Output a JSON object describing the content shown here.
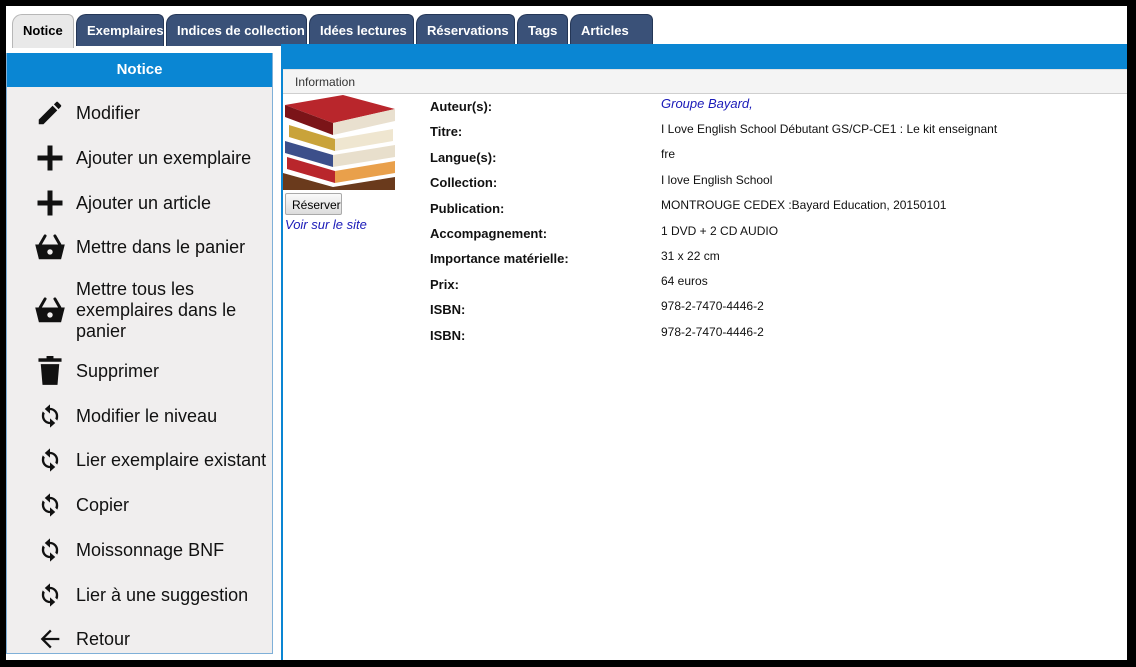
{
  "tabs": [
    {
      "label": "Notice"
    },
    {
      "label": "Exemplaires"
    },
    {
      "label": "Indices de collection"
    },
    {
      "label": "Idées lectures"
    },
    {
      "label": "Réservations"
    },
    {
      "label": "Tags"
    },
    {
      "label": "Articles"
    }
  ],
  "sidebar": {
    "title": "Notice",
    "items": [
      {
        "label": "Modifier",
        "icon": "pencil-icon"
      },
      {
        "label": "Ajouter un exemplaire",
        "icon": "plus-icon"
      },
      {
        "label": "Ajouter un article",
        "icon": "plus-icon"
      },
      {
        "label": "Mettre dans le panier",
        "icon": "basket-icon"
      },
      {
        "label": "Mettre tous les exemplaires dans le panier",
        "icon": "basket-icon"
      },
      {
        "label": "Supprimer",
        "icon": "trash-icon"
      },
      {
        "label": "Modifier le niveau",
        "icon": "refresh-icon"
      },
      {
        "label": "Lier exemplaire existant",
        "icon": "refresh-icon"
      },
      {
        "label": "Copier",
        "icon": "refresh-icon"
      },
      {
        "label": "Moissonnage BNF",
        "icon": "refresh-icon"
      },
      {
        "label": "Lier à une suggestion",
        "icon": "refresh-icon"
      },
      {
        "label": "Retour",
        "icon": "arrow-left-icon"
      }
    ]
  },
  "main": {
    "section_label": "Information",
    "reserve_button": "Réserver",
    "site_link": "Voir sur le site",
    "fields": [
      {
        "label": "Auteur(s):",
        "value": "Groupe Bayard,"
      },
      {
        "label": "Titre:",
        "value": "I Love English School Débutant GS/CP-CE1 : Le kit enseignant"
      },
      {
        "label": "Langue(s):",
        "value": "fre"
      },
      {
        "label": "Collection:",
        "value": "I love English School"
      },
      {
        "label": "Publication:",
        "value": "MONTROUGE CEDEX :Bayard Education, 20150101"
      },
      {
        "label": "Accompagnement:",
        "value": "1 DVD + 2 CD AUDIO"
      },
      {
        "label": "Importance matérielle:",
        "value": "31 x 22 cm"
      },
      {
        "label": "Prix:",
        "value": "64 euros"
      },
      {
        "label": "ISBN:",
        "value": "978-2-7470-4446-2"
      },
      {
        "label": "ISBN:",
        "value": "978-2-7470-4446-2"
      }
    ]
  },
  "colors": {
    "accent": "#0a86d3",
    "tab": "#3a5178",
    "link": "#1a1ab8"
  }
}
